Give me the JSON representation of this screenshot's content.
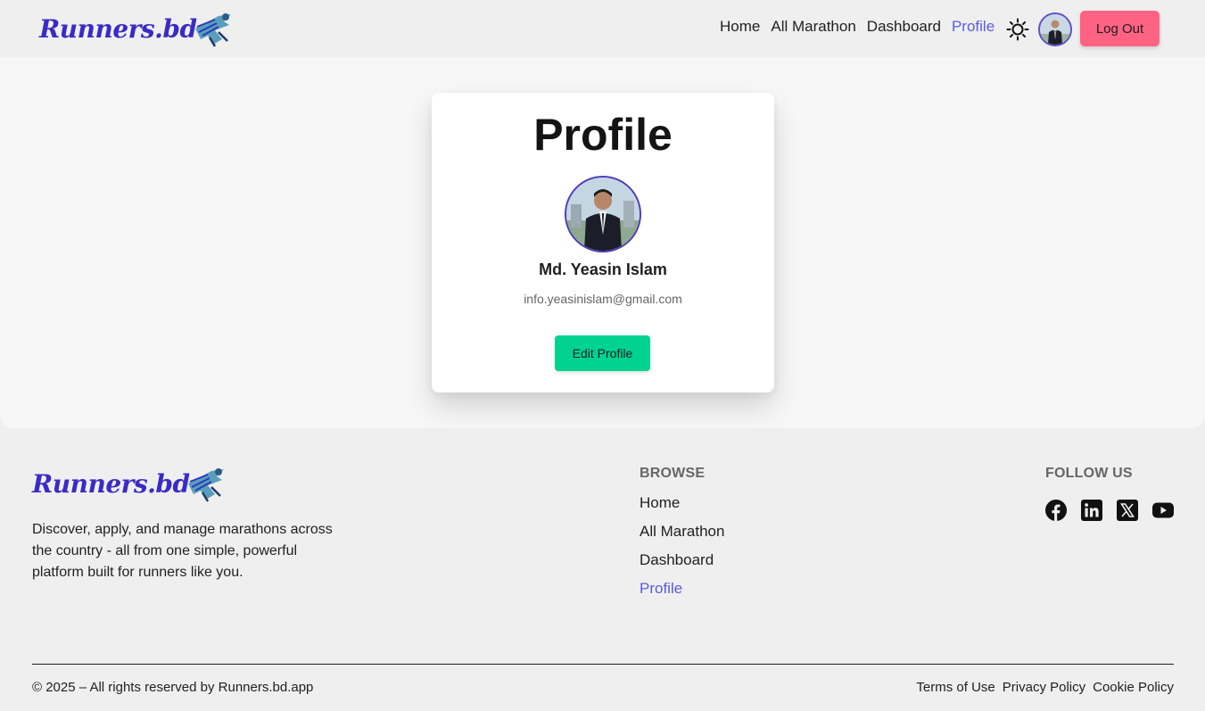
{
  "brand": {
    "logo_text": "Runners.bd"
  },
  "nav": {
    "links": [
      "Home",
      "All Marathon",
      "Dashboard",
      "Profile"
    ],
    "active": "Profile",
    "logout_label": "Log Out",
    "theme_icon": "sun-icon"
  },
  "profile": {
    "title": "Profile",
    "name": "Md. Yeasin Islam",
    "email": "info.yeasinislam@gmail.com",
    "edit_label": "Edit Profile"
  },
  "footer": {
    "description": "Discover, apply, and manage marathons across the country - all from one simple, powerful platform built for runners like you.",
    "browse_heading": "BROWSE",
    "browse_links": [
      "Home",
      "All Marathon",
      "Dashboard",
      "Profile"
    ],
    "follow_heading": "FOLLOW US",
    "social_icons": [
      "facebook-icon",
      "linkedin-icon",
      "x-icon",
      "youtube-icon"
    ],
    "copyright": "© 2025 – All rights reserved by Runners.bd.app",
    "legal_links": [
      "Terms of Use",
      "Privacy Policy",
      "Cookie Policy"
    ]
  },
  "colors": {
    "brand": "#3b2bc4",
    "active_link": "#5b5be0",
    "logout_bg": "#ff6384",
    "edit_bg": "#00d390"
  }
}
